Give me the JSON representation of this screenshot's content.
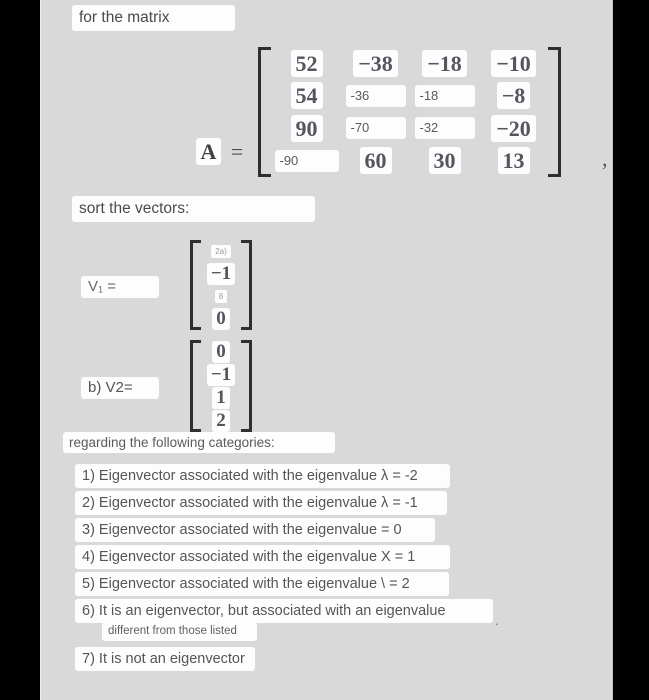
{
  "prompts": {
    "top": "for the matrix",
    "sort": "sort the vectors:",
    "regarding": "regarding the following categories:"
  },
  "matrix": {
    "label": "A",
    "equals": "=",
    "trailing_comma": ",",
    "rows": [
      [
        {
          "text": "52",
          "style": "math"
        },
        {
          "text": "−38",
          "style": "math"
        },
        {
          "text": "−18",
          "style": "math"
        },
        {
          "text": "−10",
          "style": "math"
        }
      ],
      [
        {
          "text": "54",
          "style": "math"
        },
        {
          "text": "-36",
          "style": "input"
        },
        {
          "text": "-18",
          "style": "input"
        },
        {
          "text": "−8",
          "style": "math"
        }
      ],
      [
        {
          "text": "90",
          "style": "math"
        },
        {
          "text": "-70",
          "style": "input"
        },
        {
          "text": "-32",
          "style": "input"
        },
        {
          "text": "−20",
          "style": "math"
        }
      ],
      [
        {
          "text": "-90",
          "style": "input"
        },
        {
          "text": "60",
          "style": "math"
        },
        {
          "text": "30",
          "style": "math"
        },
        {
          "text": "13",
          "style": "math"
        }
      ]
    ]
  },
  "vectors": [
    {
      "label": "V₁ =",
      "entries": [
        {
          "text": "2a)",
          "style": "blurred"
        },
        {
          "text": "−1",
          "style": "math"
        },
        {
          "text": "8",
          "style": "blurred"
        },
        {
          "text": "0",
          "style": "math"
        }
      ]
    },
    {
      "label": "b) V2=",
      "entries": [
        {
          "text": "0",
          "style": "math"
        },
        {
          "text": "−1",
          "style": "math"
        },
        {
          "text": "1",
          "style": "math"
        },
        {
          "text": "2",
          "style": "math"
        }
      ]
    }
  ],
  "options": [
    "1) Eigenvector associated with the eigenvalue λ = -2",
    "2) Eigenvector associated with the eigenvalue λ = -1",
    "3) Eigenvector associated with the eigenvalue = 0",
    "4) Eigenvector associated with the eigenvalue X = 1",
    "5) Eigenvector associated with the eigenvalue \\ = 2",
    "6) It is an eigenvector, but associated with an eigenvalue",
    "7) It is not an eigenvector"
  ],
  "option6_continuation": "different from those listed",
  "option6_trailing_mark": ".",
  "colors": {
    "page_background": "#000000",
    "sheet_background": "#d9d9d9",
    "box_background": "#fdfdfd",
    "text": "#555555",
    "bracket": "#2e2e33"
  }
}
